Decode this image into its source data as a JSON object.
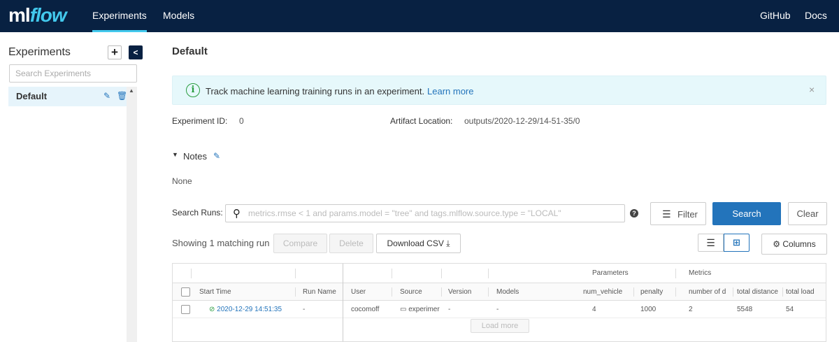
{
  "header": {
    "logo_ml": "ml",
    "logo_flow": "flow",
    "nav": {
      "experiments": "Experiments",
      "models": "Models",
      "github": "GitHub",
      "docs": "Docs"
    }
  },
  "sidebar": {
    "title": "Experiments",
    "add_label": "+",
    "collapse_label": "<",
    "search_placeholder": "Search Experiments",
    "items": [
      {
        "label": "Default"
      }
    ]
  },
  "main": {
    "title": "Default",
    "banner": {
      "text": "Track machine learning training runs in an experiment.",
      "link": "Learn more",
      "close": "×"
    },
    "experiment_id_label": "Experiment ID:",
    "experiment_id": "0",
    "artifact_label": "Artifact Location:",
    "artifact_location": "outputs/2020-12-29/14-51-35/0",
    "notes_label": "Notes",
    "notes_value": "None",
    "search": {
      "label": "Search Runs:",
      "placeholder": "metrics.rmse < 1 and params.model = \"tree\" and tags.mlflow.source.type = \"LOCAL\"",
      "help": "?",
      "filter_label": "Filter",
      "search_label": "Search",
      "clear_label": "Clear"
    },
    "toolbar": {
      "showing": "Showing 1 matching run",
      "compare": "Compare",
      "delete": "Delete",
      "download_csv": "Download CSV",
      "columns": "Columns"
    },
    "table": {
      "groups": {
        "parameters": "Parameters",
        "metrics": "Metrics"
      },
      "columns": {
        "start_time": "Start Time",
        "run_name": "Run Name",
        "user": "User",
        "source": "Source",
        "version": "Version",
        "models": "Models",
        "num_vehicle": "num_vehicle",
        "penalty": "penalty",
        "number_of_d": "number of d",
        "total_distance": "total distance",
        "total_load": "total load"
      },
      "rows": [
        {
          "start_time": "2020-12-29 14:51:35",
          "run_name": "-",
          "user": "cocomoff",
          "source": "experimer",
          "version": "-",
          "models": "-",
          "num_vehicle": "4",
          "penalty": "1000",
          "number_of_d": "2",
          "total_distance": "5548",
          "total_load": "54"
        }
      ],
      "load_more": "Load more"
    }
  },
  "colors": {
    "topbar": "#082142",
    "accent": "#43c9ed",
    "primary": "#2374bb",
    "success": "#2a9d3f"
  }
}
